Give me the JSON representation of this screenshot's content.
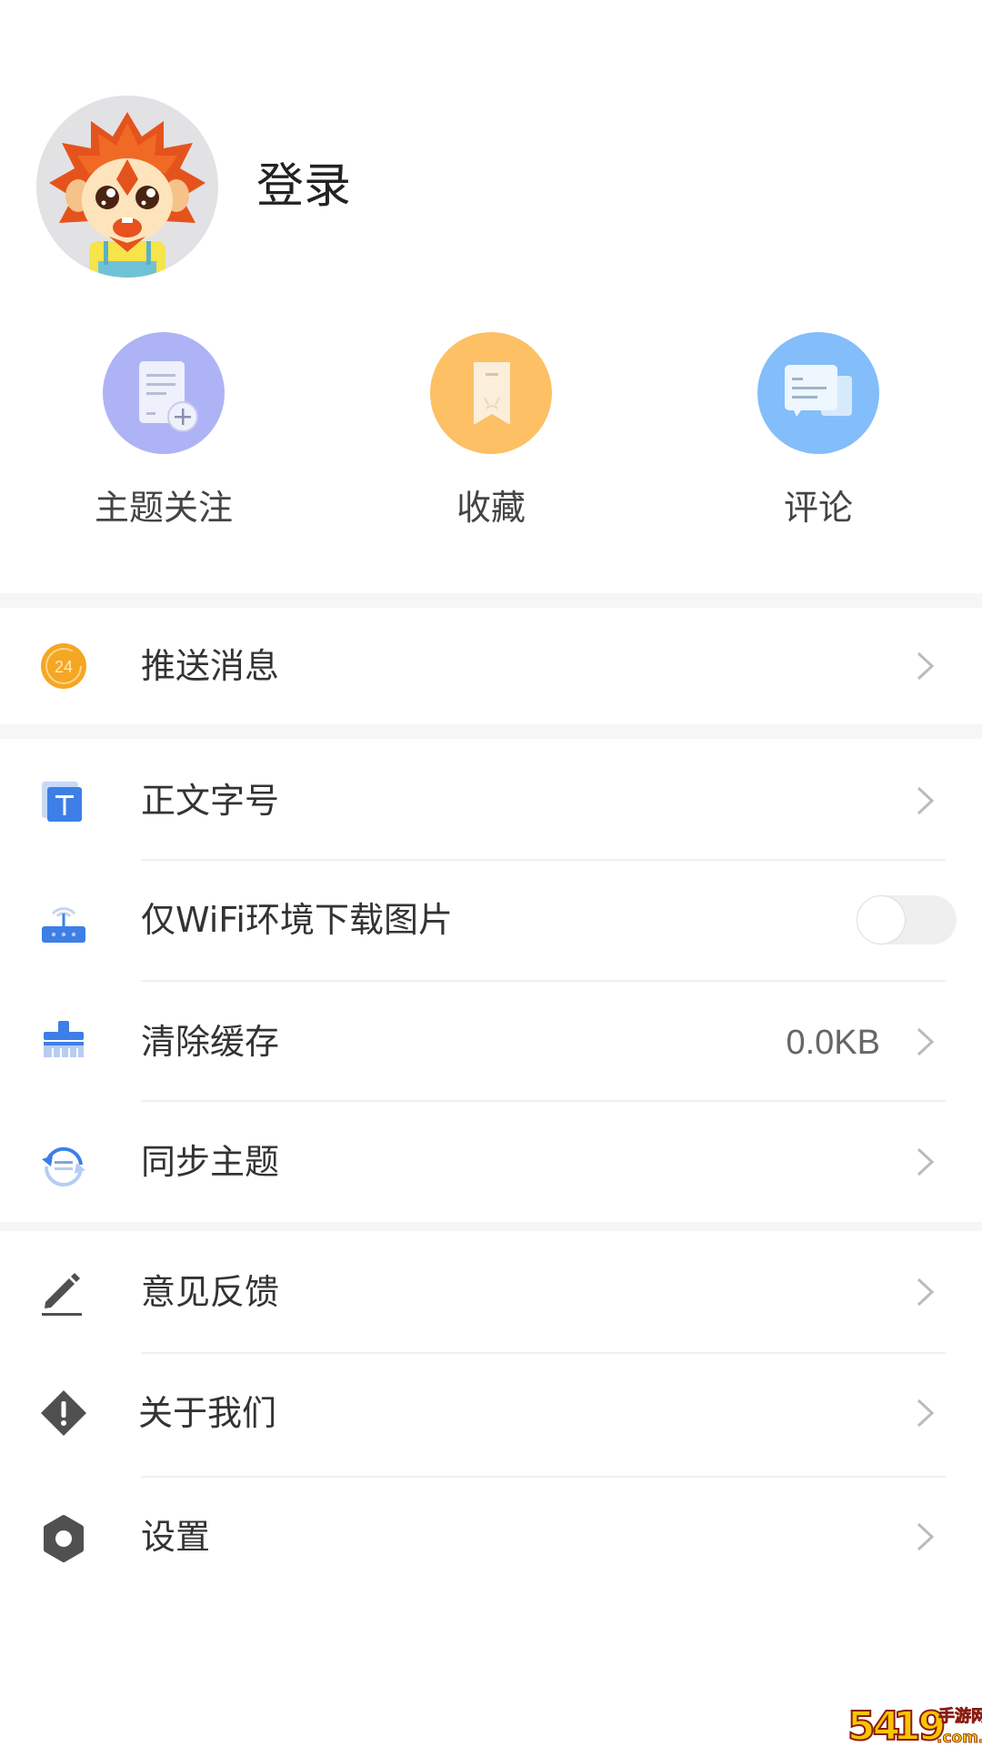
{
  "profile": {
    "avatar_alt": "cartoon lion mascot avatar",
    "login_label": "登录"
  },
  "quick_actions": [
    {
      "label": "主题关注",
      "icon": "topic-follow-icon",
      "color": "#aeb3f6"
    },
    {
      "label": "收藏",
      "icon": "bookmark-icon",
      "color": "#fdc064"
    },
    {
      "label": "评论",
      "icon": "comment-icon",
      "color": "#83bdfa"
    }
  ],
  "sections": [
    {
      "rows": [
        {
          "label": "推送消息",
          "icon": "push-message-icon",
          "badge": "24",
          "trailing": "chevron"
        }
      ]
    },
    {
      "rows": [
        {
          "label": "正文字号",
          "icon": "font-size-icon",
          "trailing": "chevron"
        },
        {
          "label": "仅WiFi环境下载图片",
          "icon": "wifi-router-icon",
          "trailing": "toggle",
          "toggle_on": false
        },
        {
          "label": "清除缓存",
          "icon": "clear-cache-icon",
          "value": "0.0KB",
          "trailing": "chevron"
        },
        {
          "label": "同步主题",
          "icon": "sync-icon",
          "trailing": "chevron"
        }
      ]
    },
    {
      "rows": [
        {
          "label": "意见反馈",
          "icon": "feedback-pencil-icon",
          "trailing": "chevron"
        },
        {
          "label": "关于我们",
          "icon": "about-info-icon",
          "trailing": "chevron"
        },
        {
          "label": "设置",
          "icon": "settings-gear-icon",
          "trailing": "chevron"
        }
      ]
    }
  ],
  "colors": {
    "accent_blue": "#3d7fe6",
    "badge_orange": "#f5a623",
    "separator": "#f6f6f6",
    "chevron": "#bbbbbb"
  },
  "watermark": {
    "text": "5419手游网",
    "subtext": ".com.cn"
  }
}
